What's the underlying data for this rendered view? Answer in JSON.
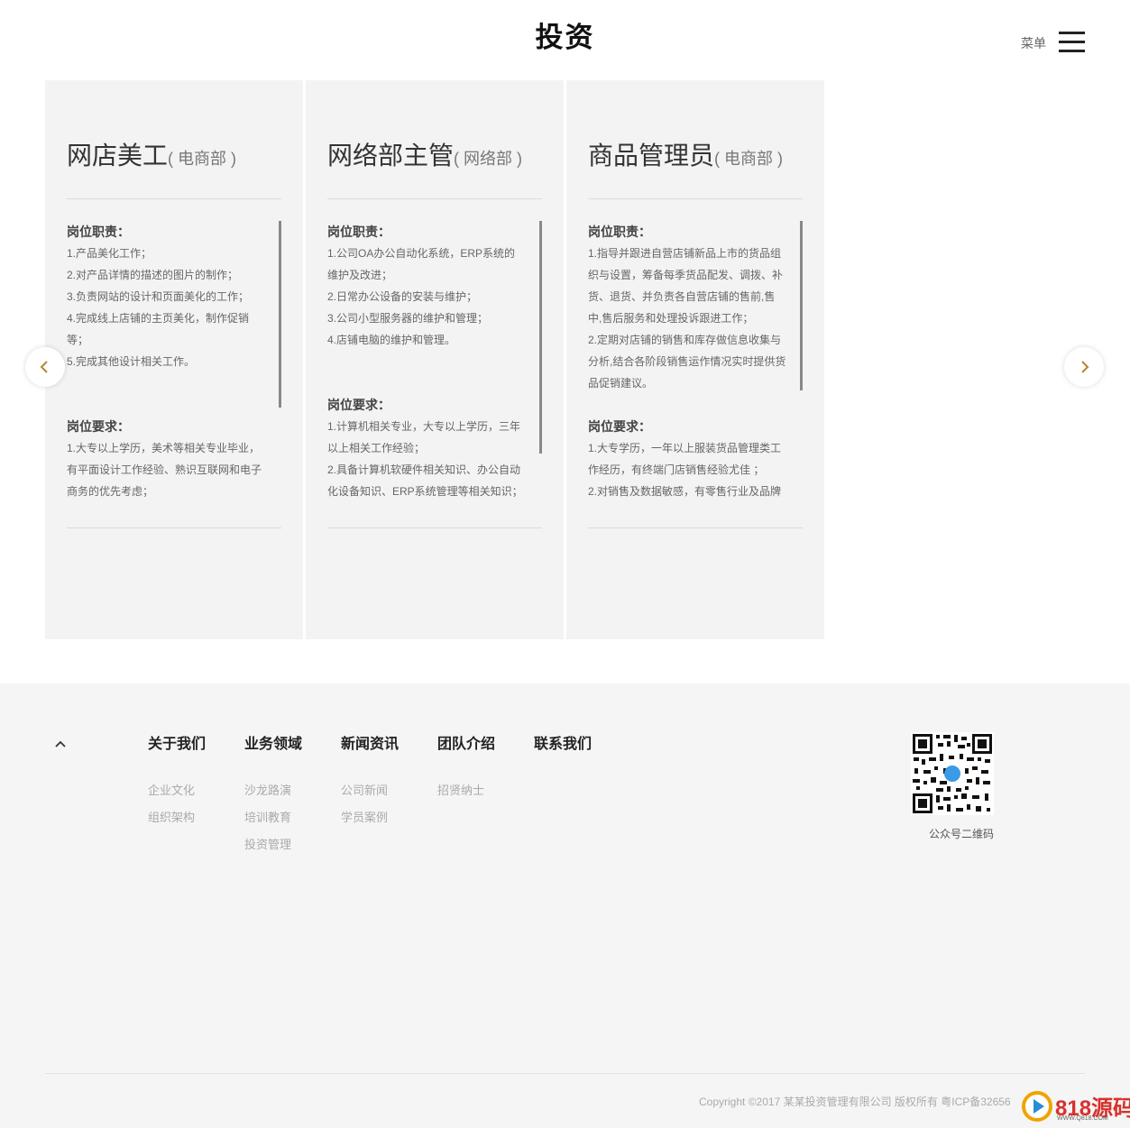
{
  "header": {
    "logo": "投资",
    "menu_label": "菜单"
  },
  "jobs": [
    {
      "name": "网店美工",
      "dept": "( 电商部 )",
      "duty_title": "岗位职责：",
      "duties": [
        "1.产品美化工作；",
        "2.对产品详情的描述的图片的制作；",
        "3.负责网站的设计和页面美化的工作；",
        "4.完成线上店铺的主页美化，制作促销等；",
        "5.完成其他设计相关工作。"
      ],
      "req_title": "岗位要求：",
      "reqs": [
        "1.大专以上学历，美术等相关专业毕业，有平面设计工作经验、熟识互联网和电子商务的优先考虑；"
      ]
    },
    {
      "name": "网络部主管",
      "dept": "( 网络部 )",
      "duty_title": "岗位职责：",
      "duties": [
        "1.公司OA办公自动化系统，ERP系统的维护及改进；",
        "2.日常办公设备的安装与维护；",
        "3.公司小型服务器的维护和管理；",
        "4.店铺电脑的维护和管理。"
      ],
      "req_title": "岗位要求：",
      "reqs": [
        "1.计算机相关专业，大专以上学历，三年以上相关工作经验；",
        "2.具备计算机软硬件相关知识、办公自动化设备知识、ERP系统管理等相关知识；"
      ]
    },
    {
      "name": "商品管理员",
      "dept": "( 电商部 )",
      "duty_title": "岗位职责：",
      "duties": [
        "1.指导并跟进自营店铺新品上市的货品组织与设置，筹备每季货品配发、调拨、补货、退货、并负责各自营店铺的售前,售中,售后服务和处理投诉跟进工作；",
        "2.定期对店铺的销售和库存做信息收集与分析,结合各阶段销售运作情况实时提供货品促销建议。"
      ],
      "req_title": "岗位要求：",
      "reqs": [
        "1.大专学历，一年以上服装货品管理类工作经历，有终端门店销售经验尤佳 ；",
        "2.对销售及数据敏感，有零售行业及品牌"
      ]
    }
  ],
  "footer": {
    "columns": [
      {
        "title": "关于我们",
        "links": [
          "企业文化",
          "组织架构"
        ]
      },
      {
        "title": "业务领域",
        "links": [
          "沙龙路演",
          "培训教育",
          "投资管理"
        ]
      },
      {
        "title": "新闻资讯",
        "links": [
          "公司新闻",
          "学员案例"
        ]
      },
      {
        "title": "团队介绍",
        "links": [
          "招贤纳士"
        ]
      },
      {
        "title": "联系我们",
        "links": []
      }
    ],
    "qr_caption": "公众号二维码",
    "copyright": "Copyright ©2017 某某投资管理有限公司 版权所有 粤ICP备32656"
  },
  "watermark": {
    "text": "818源码",
    "sub": "WWW.Q818.COM"
  },
  "colors": {
    "card_bg": "#f3f3f3",
    "footer_bg": "#f5f5f5",
    "arrow_accent": "#b8862c"
  }
}
